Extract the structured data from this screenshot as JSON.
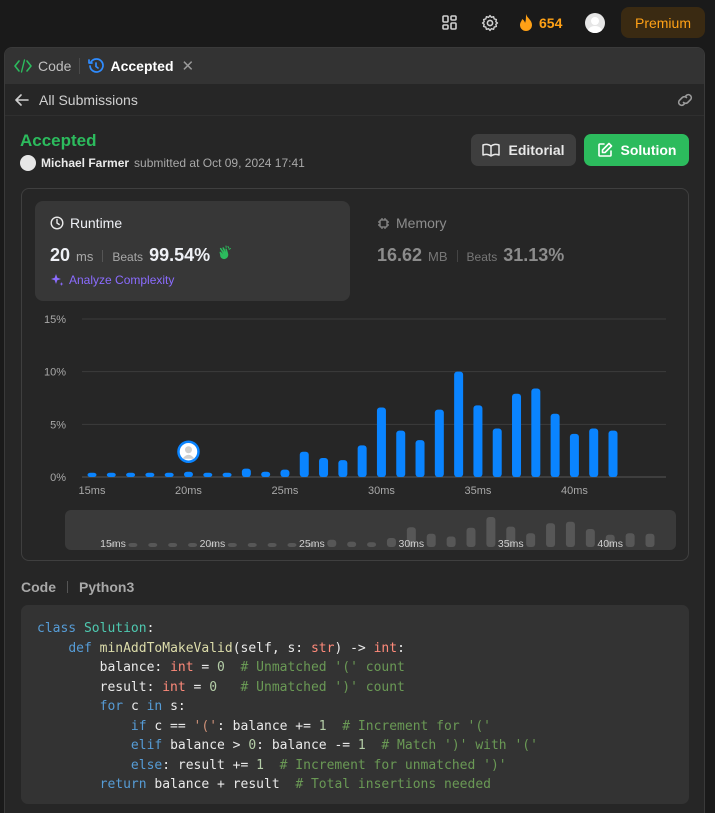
{
  "topbar": {
    "streak_count": "654",
    "premium_label": "Premium",
    "colors": {
      "streak": "#ffa116"
    }
  },
  "tabs": [
    {
      "label": "Code",
      "icon": "code-icon"
    },
    {
      "label": "Accepted",
      "icon": "history-icon"
    }
  ],
  "subbar": {
    "back_label": "All Submissions"
  },
  "submission": {
    "status": "Accepted",
    "user": "Michael Farmer",
    "submitted_text": "submitted at Oct 09, 2024 17:41",
    "status_color": "#2cbb5d"
  },
  "buttons": {
    "editorial": "Editorial",
    "solution": "Solution"
  },
  "runtime": {
    "title": "Runtime",
    "value": "20",
    "unit": "ms",
    "beats_label": "Beats",
    "beats_value": "99.54%",
    "analyze_label": "Analyze Complexity"
  },
  "memory": {
    "title": "Memory",
    "value": "16.62",
    "unit": "MB",
    "beats_label": "Beats",
    "beats_value": "31.13%"
  },
  "chart_data": {
    "type": "bar",
    "title": "",
    "xlabel": "",
    "ylabel": "",
    "x_ticks": [
      "15ms",
      "20ms",
      "25ms",
      "30ms",
      "35ms",
      "40ms"
    ],
    "y_ticks": [
      "0%",
      "5%",
      "10%",
      "15%"
    ],
    "ylim": [
      0,
      15
    ],
    "grid": true,
    "highlight_x": 20,
    "bar_color": "#0a84ff",
    "x": [
      15,
      16,
      17,
      18,
      19,
      20,
      21,
      22,
      23,
      24,
      25,
      26,
      27,
      28,
      29,
      30,
      31,
      32,
      33,
      34,
      35,
      36,
      37,
      38,
      39,
      40,
      41,
      42
    ],
    "values": [
      0.4,
      0.4,
      0.4,
      0.4,
      0.4,
      0.5,
      0.4,
      0.4,
      0.8,
      0.5,
      0.7,
      2.4,
      1.8,
      1.6,
      3.0,
      6.6,
      4.4,
      3.5,
      6.4,
      10.0,
      6.8,
      4.6,
      7.9,
      8.4,
      6.0,
      4.1,
      4.6,
      4.4
    ]
  },
  "code": {
    "header_label": "Code",
    "language": "Python3",
    "lines": [
      [
        [
          "kw",
          "class "
        ],
        [
          "cls",
          "Solution"
        ],
        [
          "",
          "："
        ]
      ],
      [
        [
          "",
          "    "
        ],
        [
          "kw",
          "def "
        ],
        [
          "fn",
          "minAddToMakeValid"
        ],
        [
          "",
          "(self, s: "
        ],
        [
          "ty",
          "str"
        ],
        [
          "",
          ") -> "
        ],
        [
          "ty",
          "int"
        ],
        [
          "",
          ":"
        ]
      ],
      [
        [
          "",
          "        balance: "
        ],
        [
          "ty",
          "int"
        ],
        [
          "",
          " = "
        ],
        [
          "num",
          "0"
        ],
        [
          "",
          "  "
        ],
        [
          "cm",
          "# Unmatched '(' count"
        ]
      ],
      [
        [
          "",
          "        result: "
        ],
        [
          "ty",
          "int"
        ],
        [
          "",
          "",
          " "
        ],
        [
          "",
          "= "
        ],
        [
          "num",
          "0"
        ],
        [
          "",
          "   "
        ],
        [
          "cm",
          "# Unmatched ')' count"
        ]
      ],
      [
        [
          "",
          "        "
        ],
        [
          "kw",
          "for "
        ],
        [
          "",
          "c "
        ],
        [
          "kw",
          "in "
        ],
        [
          "",
          "s:"
        ]
      ],
      [
        [
          "",
          "            "
        ],
        [
          "kw",
          "if "
        ],
        [
          "",
          "c == "
        ],
        [
          "str",
          "'('"
        ],
        [
          "",
          ": balance += "
        ],
        [
          "num",
          "1"
        ],
        [
          "",
          "  "
        ],
        [
          "cm",
          "# Increment for '('"
        ]
      ],
      [
        [
          "",
          "            "
        ],
        [
          "kw",
          "elif "
        ],
        [
          "",
          "balance > "
        ],
        [
          "num",
          "0"
        ],
        [
          "",
          ": balance -= "
        ],
        [
          "num",
          "1"
        ],
        [
          "",
          "  "
        ],
        [
          "cm",
          "# Match ')' with '('"
        ]
      ],
      [
        [
          "",
          "            "
        ],
        [
          "kw",
          "else"
        ],
        [
          "",
          ": result += "
        ],
        [
          "num",
          "1"
        ],
        [
          "",
          "  "
        ],
        [
          "cm",
          "# Increment for unmatched ')'"
        ]
      ],
      [
        [
          "",
          "        "
        ],
        [
          "kw",
          "return "
        ],
        [
          "",
          "balance + result  "
        ],
        [
          "cm",
          "# Total insertions needed"
        ]
      ]
    ]
  }
}
